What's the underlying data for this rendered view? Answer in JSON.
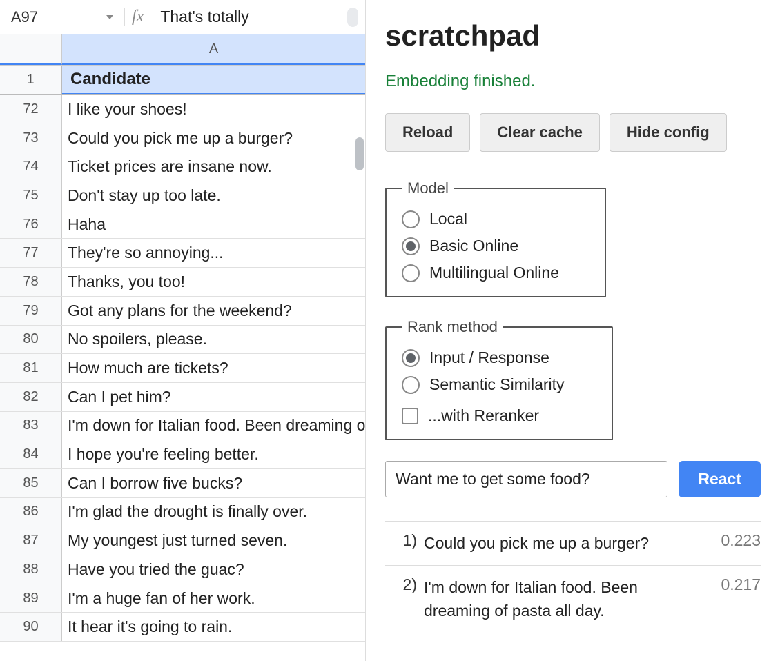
{
  "formula_bar": {
    "cell_ref": "A97",
    "fx_symbol": "fx",
    "value": "That's totally"
  },
  "sheet": {
    "column_label": "A",
    "header_row_num": "1",
    "header_label": "Candidate",
    "rows": [
      {
        "num": "72",
        "text": "I like your shoes!"
      },
      {
        "num": "73",
        "text": "Could you pick me up a burger?"
      },
      {
        "num": "74",
        "text": "Ticket prices are insane now."
      },
      {
        "num": "75",
        "text": "Don't stay up too late."
      },
      {
        "num": "76",
        "text": "Haha"
      },
      {
        "num": "77",
        "text": "They're so annoying..."
      },
      {
        "num": "78",
        "text": "Thanks, you too!"
      },
      {
        "num": "79",
        "text": "Got any plans for the weekend?"
      },
      {
        "num": "80",
        "text": "No spoilers, please."
      },
      {
        "num": "81",
        "text": "How much are tickets?"
      },
      {
        "num": "82",
        "text": "Can I pet him?"
      },
      {
        "num": "83",
        "text": "I'm down for Italian food. Been dreaming of pasta all day."
      },
      {
        "num": "84",
        "text": "I hope you're feeling better."
      },
      {
        "num": "85",
        "text": "Can I borrow five bucks?"
      },
      {
        "num": "86",
        "text": "I'm glad the drought is finally over."
      },
      {
        "num": "87",
        "text": "My youngest just turned seven."
      },
      {
        "num": "88",
        "text": "Have you tried the guac?"
      },
      {
        "num": "89",
        "text": "I'm a huge fan of her work."
      },
      {
        "num": "90",
        "text": "It hear it's going to rain."
      }
    ]
  },
  "panel": {
    "title": "scratchpad",
    "status": "Embedding finished.",
    "buttons": {
      "reload": "Reload",
      "clear_cache": "Clear cache",
      "hide_config": "Hide config"
    },
    "model": {
      "legend": "Model",
      "options": [
        {
          "label": "Local",
          "checked": false
        },
        {
          "label": "Basic Online",
          "checked": true
        },
        {
          "label": "Multilingual Online",
          "checked": false
        }
      ]
    },
    "rank": {
      "legend": "Rank method",
      "options": [
        {
          "label": "Input / Response",
          "checked": true
        },
        {
          "label": "Semantic Similarity",
          "checked": false
        }
      ],
      "reranker_label": "...with Reranker",
      "reranker_checked": false
    },
    "query": "Want me to get some food?",
    "react_label": "React",
    "results": [
      {
        "idx": "1)",
        "text": "Could you pick me up a burger?",
        "score": "0.223"
      },
      {
        "idx": "2)",
        "text": "I'm down for Italian food. Been dreaming of pasta all day.",
        "score": "0.217"
      }
    ]
  }
}
